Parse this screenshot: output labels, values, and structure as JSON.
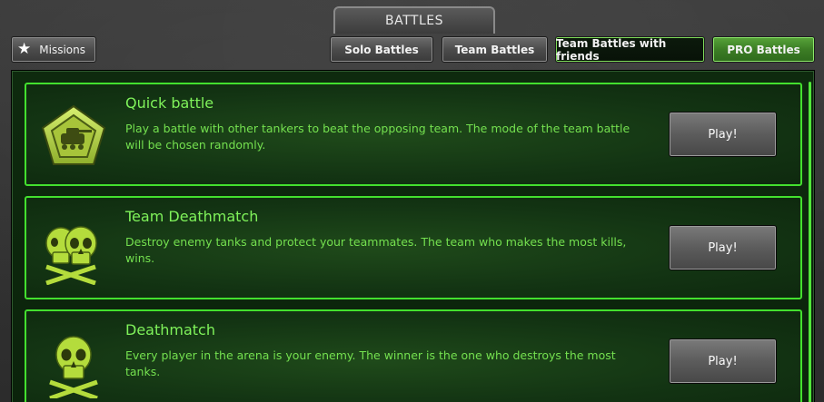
{
  "header": {
    "title": "BATTLES"
  },
  "toolbar": {
    "missions_label": "Missions",
    "solo_label": "Solo Battles",
    "team_label": "Team Battles",
    "friends_label": "Team Battles with friends",
    "pro_label": "PRO Battles"
  },
  "modes": [
    {
      "title": "Quick battle",
      "description": "Play a battle with other tankers to beat the opposing team. The mode of the team battle will be chosen randomly.",
      "button": "Play!",
      "icon": "tank-emblem-icon"
    },
    {
      "title": "Team Deathmatch",
      "description": "Destroy enemy tanks and protect your teammates. The team who makes the most kills, wins.",
      "button": "Play!",
      "icon": "double-skull-icon"
    },
    {
      "title": "Deathmatch",
      "description": "Every player in the arena is your enemy. The winner is the one who destroys the most tanks.",
      "button": "Play!",
      "icon": "skull-icon"
    }
  ],
  "colors": {
    "accent_green": "#43e02e",
    "text_green": "#74e04f",
    "panel_bg": "#0e2a0e"
  }
}
